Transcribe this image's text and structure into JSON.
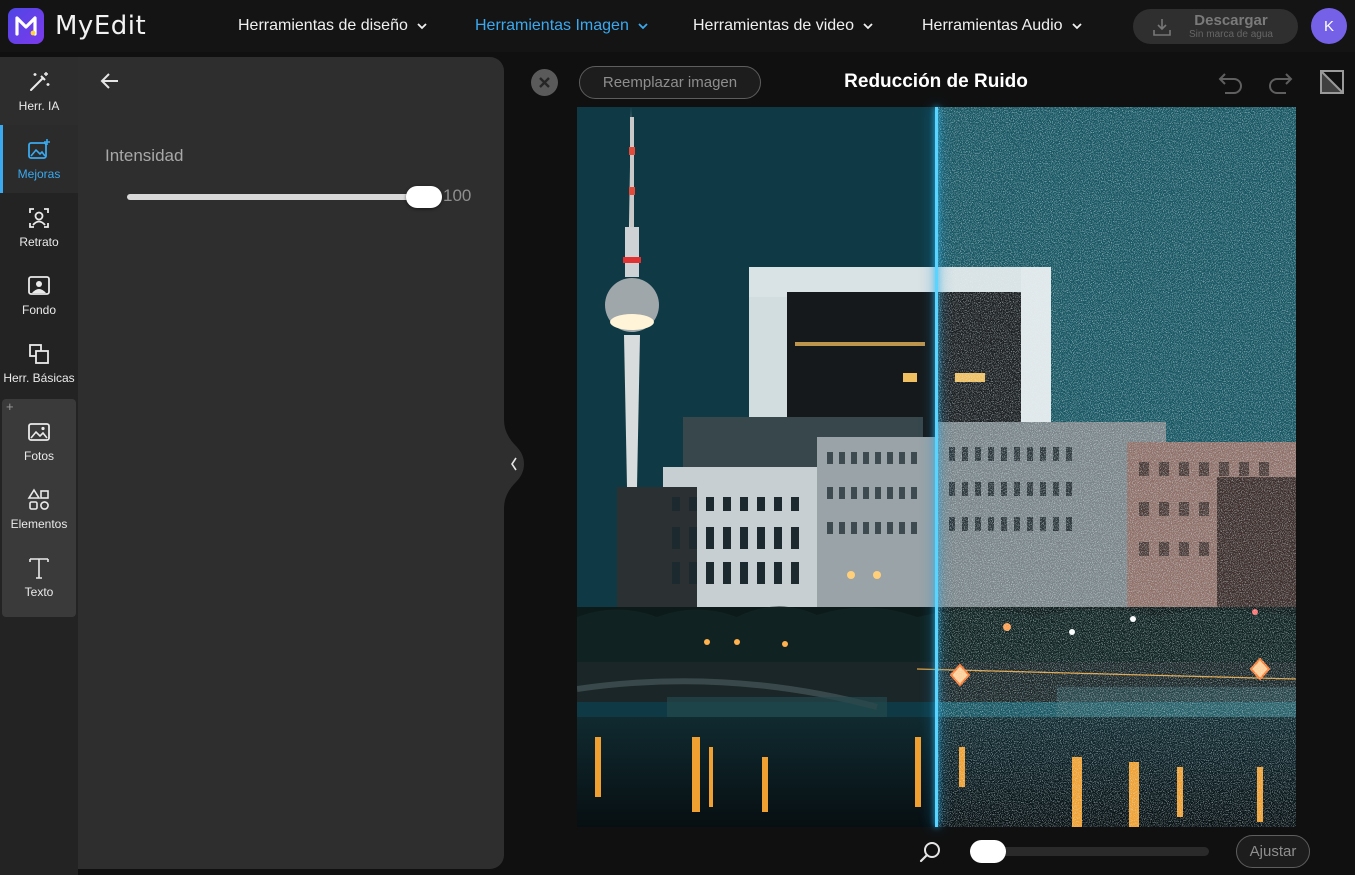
{
  "app": {
    "name": "MyEdit",
    "avatar_initial": "K"
  },
  "nav": {
    "items": [
      {
        "label": "Herramientas de diseño",
        "active": false
      },
      {
        "label": "Herramientas Imagen",
        "active": true
      },
      {
        "label": "Herramientas de video",
        "active": false
      },
      {
        "label": "Herramientas Audio",
        "active": false
      }
    ],
    "download": {
      "label": "Descargar",
      "sublabel": "Sin marca de agua",
      "icon": "download-icon"
    }
  },
  "rail": {
    "items": [
      {
        "label": "Herr. IA",
        "icon": "magic-wand-icon"
      },
      {
        "label": "Mejoras",
        "icon": "image-sparkle-icon",
        "active": true
      },
      {
        "label": "Retrato",
        "icon": "portrait-icon"
      },
      {
        "label": "Fondo",
        "icon": "background-icon"
      },
      {
        "label": "Herr. Básicas",
        "icon": "crop-copy-icon"
      }
    ],
    "group_plus": "+",
    "group_items": [
      {
        "label": "Fotos",
        "icon": "photo-icon"
      },
      {
        "label": "Elementos",
        "icon": "shapes-icon"
      },
      {
        "label": "Texto",
        "icon": "text-icon"
      }
    ]
  },
  "panel": {
    "intensity": {
      "label": "Intensidad",
      "value": 100,
      "max": 100,
      "display": "100"
    }
  },
  "canvas": {
    "replace_label": "Reemplazar imagen",
    "title": "Reducción de Ruido",
    "fit_label": "Ajustar",
    "zoom_fraction": 0.0,
    "split_fraction": 0.5
  },
  "colors": {
    "accent": "#3aa9ef",
    "split_line": "#59d4ff",
    "avatar": "#7561e8",
    "sky": "#0f3a45"
  }
}
